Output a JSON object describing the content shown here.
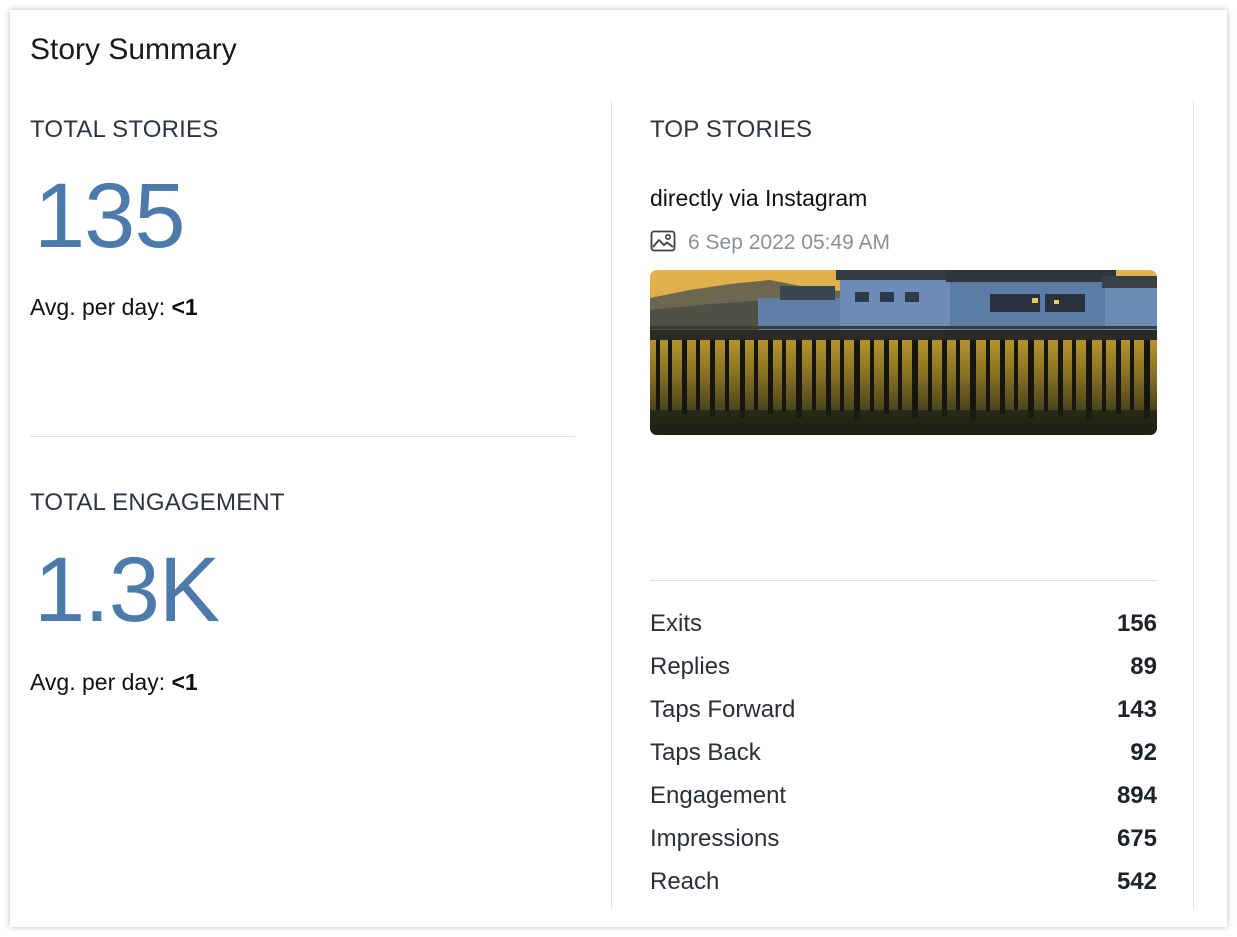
{
  "card": {
    "title": "Story Summary"
  },
  "total_stories": {
    "heading": "TOTAL STORIES",
    "value": "135",
    "avg_label": "Avg. per day:",
    "avg_value": "<1"
  },
  "total_engagement": {
    "heading": "TOTAL ENGAGEMENT",
    "value": "1.3K",
    "avg_label": "Avg. per day:",
    "avg_value": "<1"
  },
  "top_stories": {
    "heading": "TOP STORIES",
    "source": "directly via Instagram",
    "date_icon": "image-icon",
    "date": "6 Sep 2022 05:49 AM",
    "image_alt": "story-thumbnail",
    "metrics": [
      {
        "label": "Exits",
        "value": "156"
      },
      {
        "label": "Replies",
        "value": "89"
      },
      {
        "label": "Taps Forward",
        "value": "143"
      },
      {
        "label": "Taps Back",
        "value": "92"
      },
      {
        "label": "Engagement",
        "value": "894"
      },
      {
        "label": "Impressions",
        "value": "675"
      },
      {
        "label": "Reach",
        "value": "542"
      }
    ]
  },
  "colors": {
    "accent_number": "#4b7aab",
    "divider": "#dcdfe3",
    "muted_text": "#8a8f96"
  }
}
